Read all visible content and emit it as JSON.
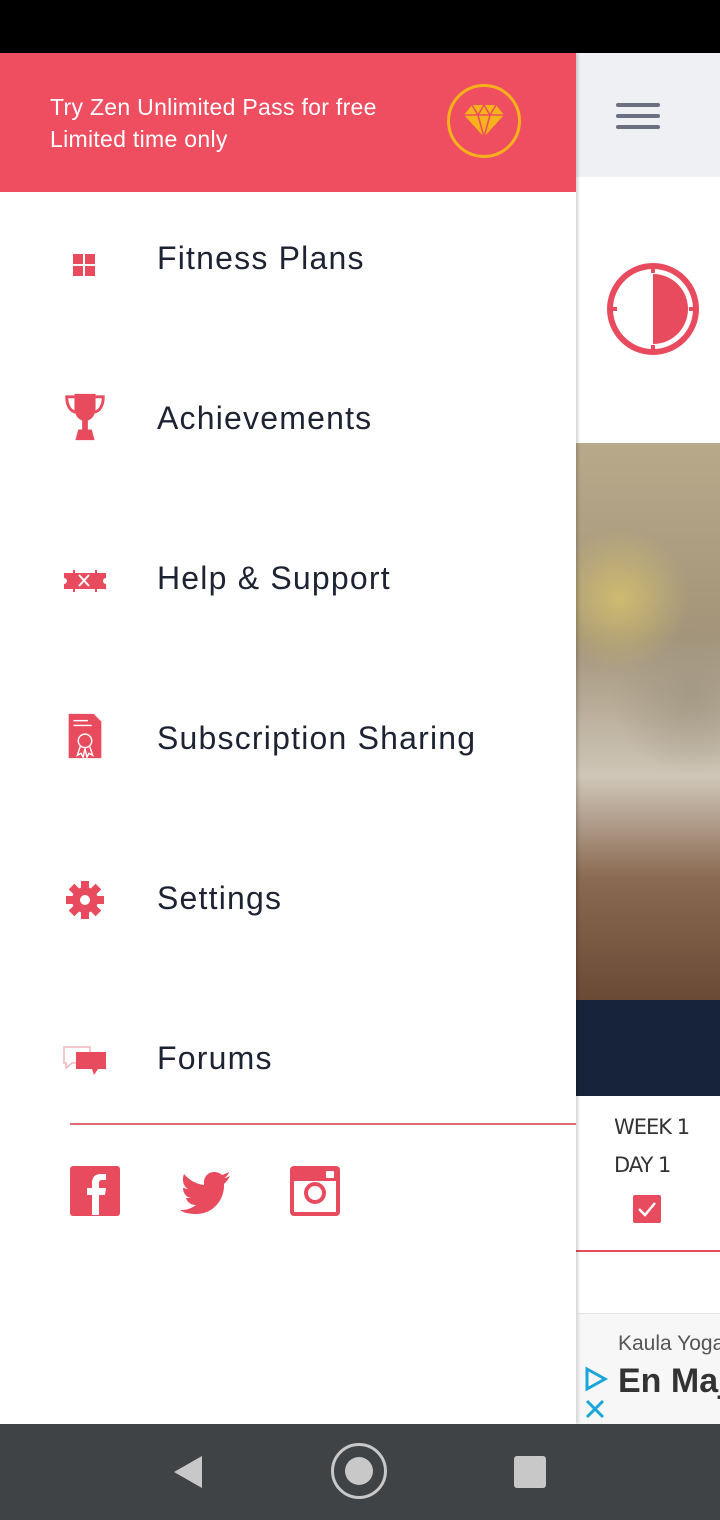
{
  "promo": {
    "line1": "Try Zen Unlimited Pass for free",
    "line2": "Limited time only",
    "icon": "diamond-icon",
    "colors": {
      "banner": "#ef4d60",
      "icon": "#f6b21a"
    }
  },
  "menu": {
    "items": [
      {
        "label": "Fitness Plans",
        "icon": "grid-icon"
      },
      {
        "label": "Achievements",
        "icon": "trophy-icon"
      },
      {
        "label": "Help & Support",
        "icon": "support-ticket-icon"
      },
      {
        "label": "Subscription Sharing",
        "icon": "certificate-icon"
      },
      {
        "label": "Settings",
        "icon": "gear-icon"
      },
      {
        "label": "Forums",
        "icon": "chat-bubbles-icon"
      }
    ]
  },
  "social": [
    {
      "name": "facebook",
      "icon": "facebook-icon"
    },
    {
      "name": "twitter",
      "icon": "twitter-icon"
    },
    {
      "name": "instagram",
      "icon": "instagram-icon"
    }
  ],
  "background": {
    "week_line1": "WEEK 1",
    "week_line2": "DAY 1",
    "ad_subtitle": "Kaula Yoga",
    "ad_title": "En Maj"
  },
  "nav": {
    "back": "back-icon",
    "home": "home-icon",
    "recent": "recent-apps-icon"
  },
  "colors": {
    "accent": "#ef4d60",
    "text": "#1d2333",
    "nav_bar": "#3f4346",
    "dark_band": "#16233a"
  }
}
